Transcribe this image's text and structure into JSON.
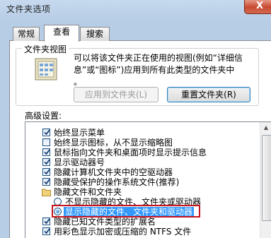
{
  "window": {
    "title": "文件夹选项",
    "close_label": "X"
  },
  "tabs": [
    {
      "label": "常规",
      "active": false
    },
    {
      "label": "查看",
      "active": true
    },
    {
      "label": "搜索",
      "active": false
    }
  ],
  "folder_views": {
    "heading": "文件夹视图",
    "description_line1": "可以将该文件夹正在使用的视图(例如“详细信",
    "description_line2": "息”或“图标”)应用到所有此类型的文件夹中",
    "description_line3": "。",
    "apply_button": "应用到文件夹(L)",
    "reset_button": "重置文件夹(R)",
    "icon": "folder-view-icon"
  },
  "advanced": {
    "label": "高级设置:",
    "items": [
      {
        "type": "checkbox",
        "checked": true,
        "label": "始终显示菜单"
      },
      {
        "type": "checkbox",
        "checked": false,
        "label": "始终显示图标，从不显示缩略图"
      },
      {
        "type": "checkbox",
        "checked": true,
        "label": "鼠标指向文件夹和桌面项时显示提示信息"
      },
      {
        "type": "checkbox",
        "checked": true,
        "label": "显示驱动器号"
      },
      {
        "type": "checkbox",
        "checked": true,
        "label": "隐藏计算机文件夹中的空驱动器"
      },
      {
        "type": "checkbox",
        "checked": true,
        "label": "隐藏受保护的操作系统文件(推荐)"
      },
      {
        "type": "folder",
        "label": "隐藏文件和文件夹"
      },
      {
        "type": "radio",
        "checked": false,
        "label": "不显示隐藏的文件、文件夹或驱动器"
      },
      {
        "type": "radio",
        "checked": true,
        "label": "显示隐藏的文件、文件夹和驱动器"
      },
      {
        "type": "checkbox",
        "checked": true,
        "label": "隐藏已知文件类型的扩展名"
      },
      {
        "type": "checkbox",
        "checked": true,
        "label": "用彩色显示加密或压缩的 NTFS 文件"
      }
    ]
  },
  "colors": {
    "selection": "#3399ff",
    "annotation": "#c8141e"
  }
}
